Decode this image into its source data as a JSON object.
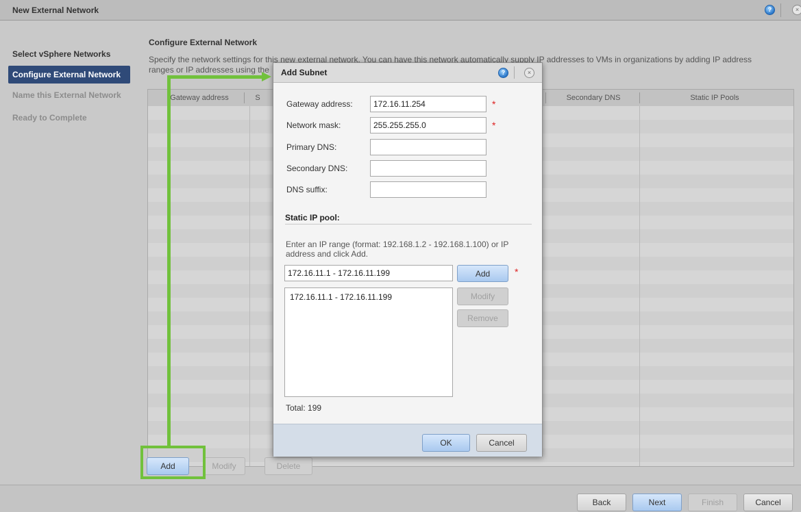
{
  "window": {
    "title": "New External Network",
    "help_icon": "help-icon",
    "close_icon": "close-icon"
  },
  "sidebar": {
    "items": [
      {
        "label": "Select vSphere Networks",
        "state": "done"
      },
      {
        "label": "Configure External Network",
        "state": "active"
      },
      {
        "label": "Name this External Network",
        "state": "todo"
      },
      {
        "label": "Ready to Complete",
        "state": "todo"
      }
    ]
  },
  "main": {
    "title": "Configure External Network",
    "description_line1": "Specify the network settings for this new external network. You can have this network automatically supply IP addresses to VMs in organizations by adding IP address",
    "description_line2": "ranges or IP addresses using the",
    "table": {
      "columns": [
        "Gateway address",
        "S",
        "Secondary DNS",
        "Static IP Pools"
      ]
    },
    "buttons": {
      "add": "Add",
      "modify": "Modify",
      "delete": "Delete"
    }
  },
  "footer": {
    "back": "Back",
    "next": "Next",
    "finish": "Finish",
    "cancel": "Cancel"
  },
  "dialog": {
    "title": "Add Subnet",
    "fields": {
      "gateway": {
        "label": "Gateway address:",
        "value": "172.16.11.254",
        "required": true
      },
      "netmask": {
        "label": "Network mask:",
        "value": "255.255.255.0",
        "required": true
      },
      "primary_dns": {
        "label": "Primary DNS:",
        "value": ""
      },
      "secondary_dns": {
        "label": "Secondary DNS:",
        "value": ""
      },
      "dns_suffix": {
        "label": "DNS suffix:",
        "value": ""
      }
    },
    "static_pool": {
      "heading": "Static IP pool:",
      "hint": "Enter an IP range (format: 192.168.1.2 - 192.168.1.100) or IP address and click Add.",
      "input_value": "172.16.11.1 - 172.16.11.199",
      "add": "Add",
      "modify": "Modify",
      "remove": "Remove",
      "items": [
        "172.16.11.1 - 172.16.11.199"
      ],
      "total": "Total: 199"
    },
    "ok": "OK",
    "cancel": "Cancel"
  },
  "colors": {
    "highlight": "#71c13c",
    "active_step": "#2f4a78",
    "required": "#d22222"
  }
}
